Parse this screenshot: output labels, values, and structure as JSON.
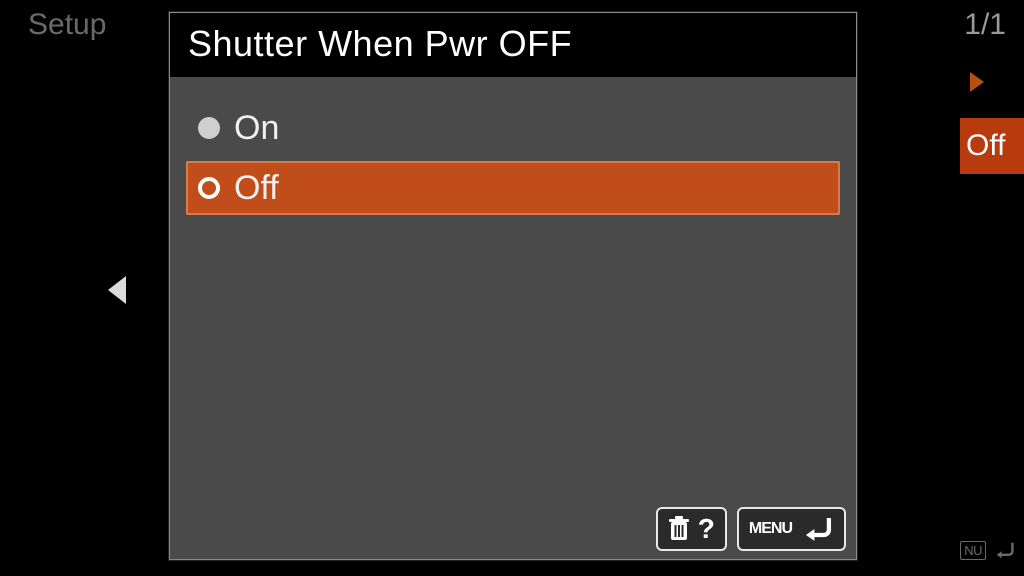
{
  "background": {
    "setup_label": "Setup",
    "pager": "1/1",
    "value_label": "Off",
    "small_menu_nu": "NU"
  },
  "dialog": {
    "title": "Shutter When Pwr OFF",
    "options": [
      {
        "label": "On",
        "selected": false
      },
      {
        "label": "Off",
        "selected": true
      }
    ],
    "footer": {
      "help_question": "?",
      "menu_label": "MENU"
    }
  }
}
